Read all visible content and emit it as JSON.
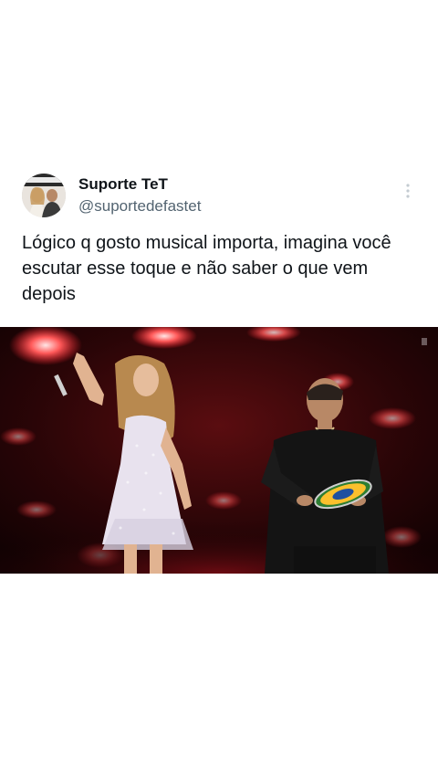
{
  "tweet": {
    "display_name": "Suporte TeT",
    "handle": "@suportedefastet",
    "text": "Lógico q gosto musical importa, imagina você escutar esse toque e não saber o que vem depois",
    "more_icon": "vertical-ellipsis-icon",
    "media_type": "video-frame"
  },
  "colors": {
    "name": "#0f1419",
    "handle": "#536471",
    "background": "#ffffff"
  }
}
